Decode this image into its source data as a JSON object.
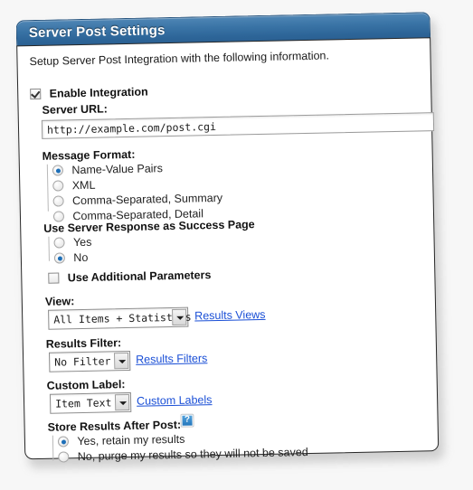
{
  "panel": {
    "title": "Server Post Settings",
    "intro": "Setup Server Post Integration with the following information.",
    "accent_color": "#2d6598",
    "link_color": "#1a4fd6",
    "radio_dot_color": "#1d6fb8"
  },
  "enable_integration": {
    "label": "Enable Integration",
    "checked": true
  },
  "server_url": {
    "label": "Server URL:",
    "value": "http://example.com/post.cgi",
    "placeholder": "http://example.com/post.cgi"
  },
  "message_format": {
    "label": "Message Format:",
    "options": [
      {
        "label": "Name-Value Pairs",
        "selected": true
      },
      {
        "label": "XML",
        "selected": false
      },
      {
        "label": "Comma-Separated, Summary",
        "selected": false
      },
      {
        "label": "Comma-Separated, Detail",
        "selected": false
      }
    ]
  },
  "use_server_response": {
    "label": "Use Server Response as Success Page",
    "options": [
      {
        "label": "Yes",
        "selected": false
      },
      {
        "label": "No",
        "selected": true
      }
    ]
  },
  "additional_parameters": {
    "label": "Use Additional Parameters",
    "checked": false
  },
  "view": {
    "label": "View:",
    "value": "All Items + Statistics",
    "options": [
      "All Items + Statistics"
    ],
    "link": "Results Views"
  },
  "results_filter": {
    "label": "Results Filter:",
    "value": "No Filter",
    "options": [
      "No Filter"
    ],
    "link": "Results Filters"
  },
  "custom_label": {
    "label": "Custom Label:",
    "value": "Item Text",
    "options": [
      "Item Text"
    ],
    "link": "Custom Labels"
  },
  "store_results": {
    "label": "Store Results After Post:",
    "help_icon": "help-question-icon",
    "help_glyph": "?",
    "options": [
      {
        "label": "Yes, retain my results",
        "selected": true
      },
      {
        "label": "No, purge my results so they will not be saved",
        "selected": false
      }
    ]
  }
}
